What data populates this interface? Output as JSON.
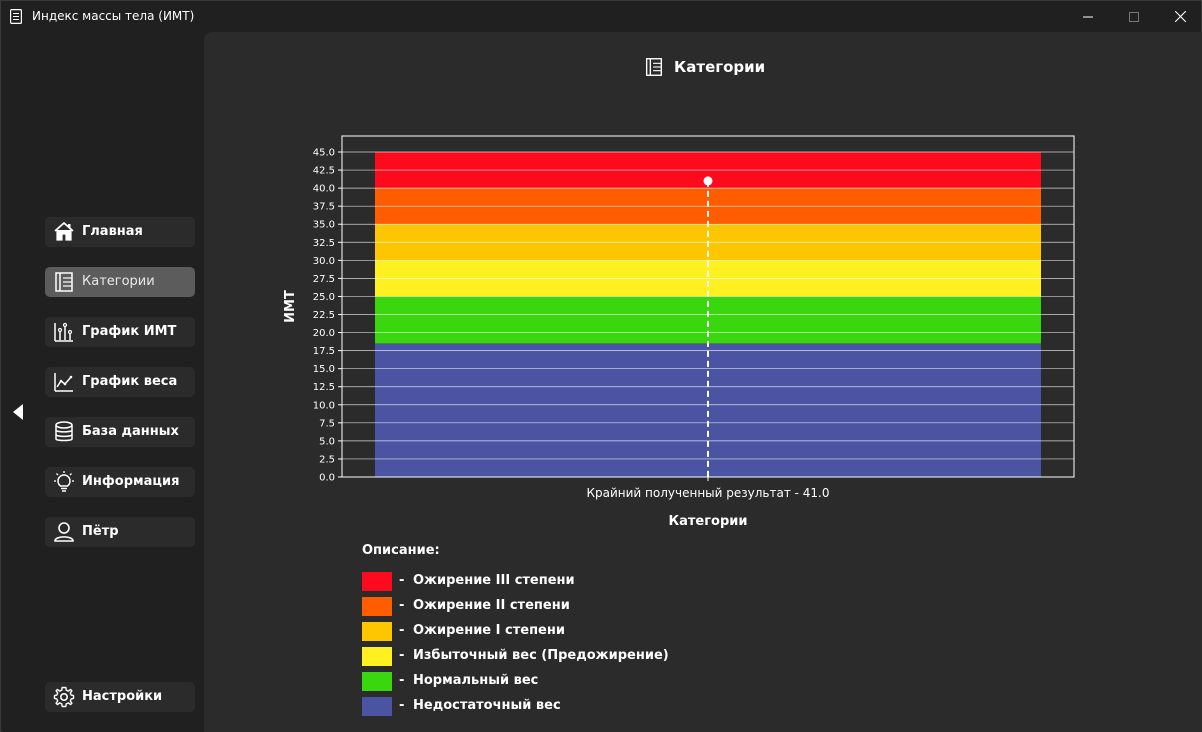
{
  "window": {
    "title": "Индекс массы тела (ИМТ)",
    "icon": "document-icon"
  },
  "sidebar": {
    "items": [
      {
        "label": "Главная",
        "icon": "home-icon",
        "active": false
      },
      {
        "label": "Категории",
        "icon": "categories-icon",
        "active": true
      },
      {
        "label": "График ИМТ",
        "icon": "bar-chart-icon",
        "active": false
      },
      {
        "label": "График веса",
        "icon": "line-chart-icon",
        "active": false
      },
      {
        "label": "База данных",
        "icon": "database-icon",
        "active": false
      },
      {
        "label": "Информация",
        "icon": "lightbulb-icon",
        "active": false
      },
      {
        "label": "Пётр",
        "icon": "user-icon",
        "active": false
      }
    ],
    "settings": {
      "label": "Настройки",
      "icon": "gear-icon"
    }
  },
  "main": {
    "title": "Категории",
    "title_icon": "categories-icon"
  },
  "chart_data": {
    "type": "bar",
    "stacked": true,
    "xlabel": "Категории",
    "ylabel": "ИМТ",
    "ylim": [
      0,
      45
    ],
    "y_ticks": [
      "0.0",
      "2.5",
      "5.0",
      "7.5",
      "10.0",
      "12.5",
      "15.0",
      "17.5",
      "20.0",
      "22.5",
      "25.0",
      "27.5",
      "30.0",
      "32.5",
      "35.0",
      "37.5",
      "40.0",
      "42.5",
      "45.0"
    ],
    "x_tick_label": "Крайний полученный результат - 41.0",
    "grid": true,
    "bands": [
      {
        "from": 0,
        "to": 18.5,
        "color": "#4a54a2"
      },
      {
        "from": 18.5,
        "to": 25,
        "color": "#3ad60e"
      },
      {
        "from": 25,
        "to": 30,
        "color": "#fef021"
      },
      {
        "from": 30,
        "to": 35,
        "color": "#fec600"
      },
      {
        "from": 35,
        "to": 40,
        "color": "#ff5d00"
      },
      {
        "from": 40,
        "to": 45,
        "color": "#fe0a1d"
      }
    ],
    "result_value": 41.0,
    "background": "#2b2b2b",
    "axis_color": "#ffffff"
  },
  "description": {
    "title": "Описание:",
    "items": [
      {
        "label": "Ожирение III степени",
        "color": "#fe0a1d"
      },
      {
        "label": "Ожирение II степени",
        "color": "#ff5d00"
      },
      {
        "label": "Ожирение I степени",
        "color": "#fec600"
      },
      {
        "label": "Избыточный вес (Предожирение)",
        "color": "#fef021"
      },
      {
        "label": "Нормальный вес",
        "color": "#3ad60e"
      },
      {
        "label": "Недостаточный вес",
        "color": "#4a54a2"
      }
    ]
  }
}
